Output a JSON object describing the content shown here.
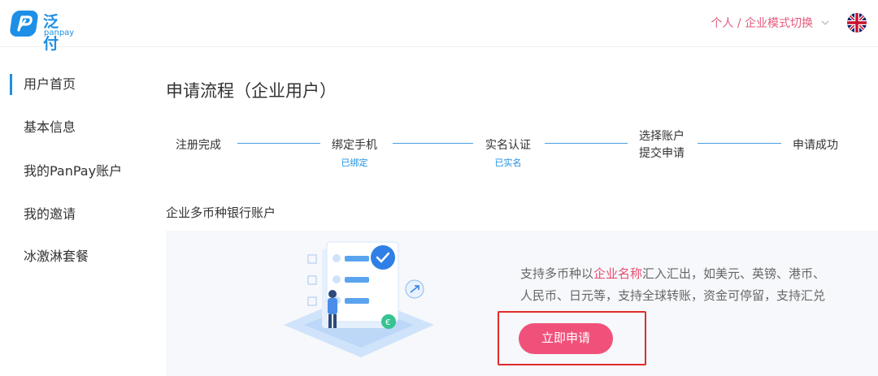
{
  "brand": {
    "name_cn": "泛付",
    "name_en": "panpay",
    "primary_color": "#1e8fe6",
    "accent_color": "#f0517a"
  },
  "header": {
    "mode_switch_label": "个人 / 企业模式切换",
    "language_icon": "uk-flag-icon"
  },
  "sidebar": {
    "items": [
      {
        "label": "用户首页",
        "active": true
      },
      {
        "label": "基本信息",
        "active": false
      },
      {
        "label": "我的PanPay账户",
        "active": false
      },
      {
        "label": "我的邀请",
        "active": false
      },
      {
        "label": "冰激淋套餐",
        "active": false
      }
    ]
  },
  "main": {
    "title": "申请流程（企业用户）",
    "steps": [
      {
        "label": "注册完成",
        "status": ""
      },
      {
        "label": "绑定手机",
        "status": "已绑定"
      },
      {
        "label": "实名认证",
        "status": "已实名"
      },
      {
        "label_line1": "选择账户",
        "label_line2": "提交申请"
      },
      {
        "label": "申请成功",
        "status": ""
      }
    ],
    "section_title": "企业多币种银行账户",
    "description": {
      "part1": "支持多币种以",
      "highlight": "企业名称",
      "part2": "汇入汇出，如美元、英镑、港币、",
      "line2": "人民币、日元等，支持全球转账，资金可停留，支持汇兑"
    },
    "apply_button": "立即申请"
  }
}
